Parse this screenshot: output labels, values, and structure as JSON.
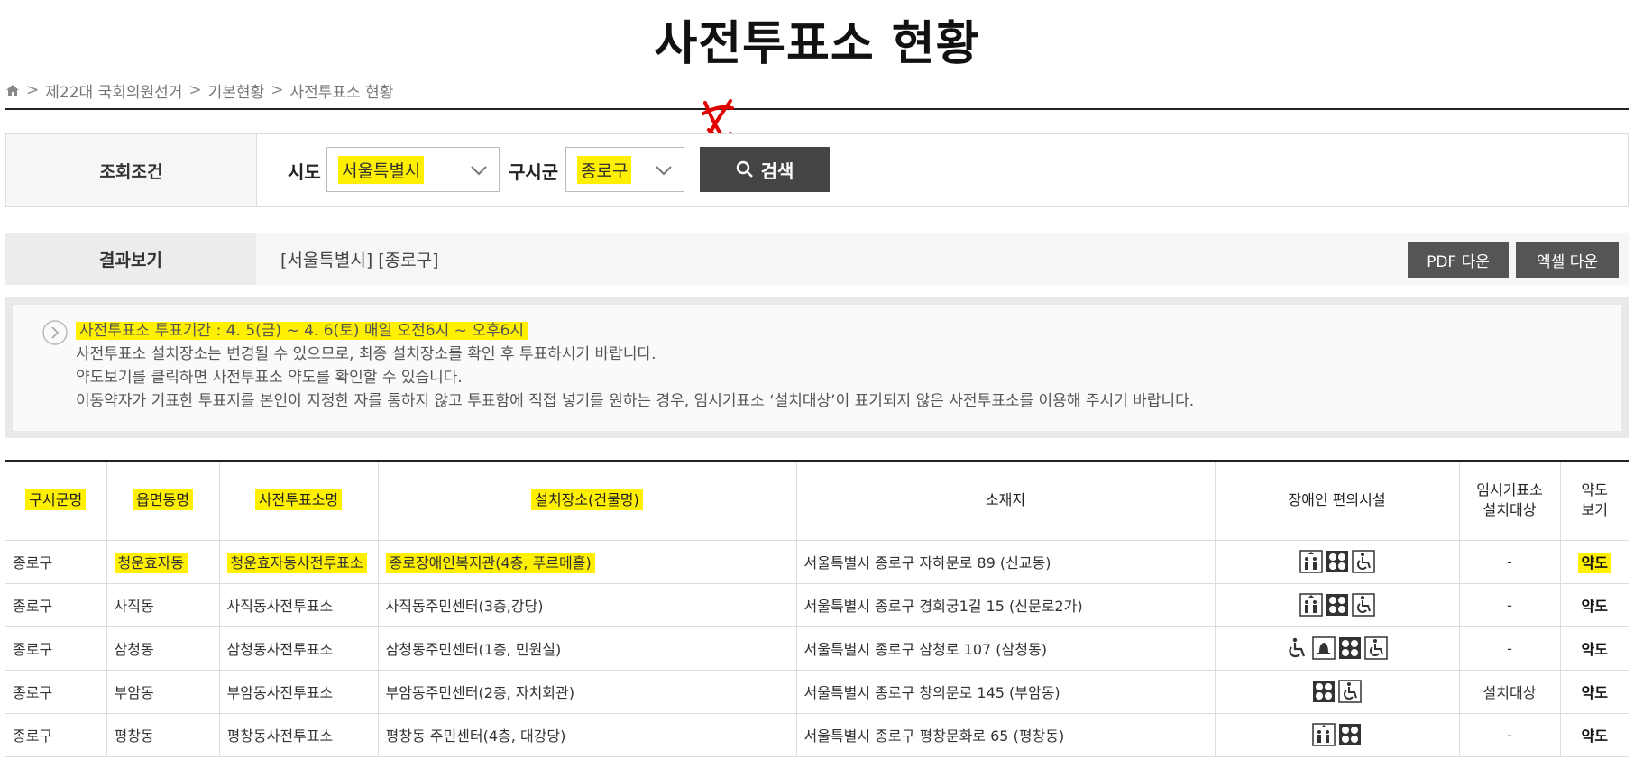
{
  "page_title": "사전투표소 현황",
  "breadcrumb": [
    "제22대 국회의원선거",
    "기본현황",
    "사전투표소 현황"
  ],
  "search": {
    "label": "조회조건",
    "sido_label": "시도",
    "sido_value": "서울특별시",
    "gu_label": "구시군",
    "gu_value": "종로구",
    "button": "검색"
  },
  "result": {
    "label": "결과보기",
    "text": "[서울특별시]  [종로구]",
    "pdf_button": "PDF 다운",
    "excel_button": "엑셀 다운"
  },
  "notice": {
    "line1": "사전투표소 투표기간 : 4. 5(금) ~ 4. 6(토) 매일 오전6시 ~ 오후6시",
    "line2": "사전투표소 설치장소는 변경될 수 있으므로, 최종 설치장소를 확인 후 투표하시기 바랍니다.",
    "line3": "약도보기를 클릭하면 사전투표소 약도를 확인할 수 있습니다.",
    "line4": "이동약자가 기표한 투표지를 본인이 지정한 자를 통하지 않고 투표함에 직접 넣기를 원하는 경우, 임시기표소 ‘설치대상’이 표기되지 않은 사전투표소를 이용해 주시기 바랍니다."
  },
  "table": {
    "headers": {
      "gu": "구시군명",
      "dong": "읍면동명",
      "station": "사전투표소명",
      "place": "설치장소(건물명)",
      "address": "소재지",
      "facility": "장애인 편의시설",
      "temp1": "임시기표소",
      "temp2": "설치대상",
      "map1": "약도",
      "map2": "보기"
    },
    "rows": [
      {
        "gu": "종로구",
        "dong": "청운효자동",
        "station": "청운효자동사전투표소",
        "place": "종로장애인복지관(4층, 푸르메홀)",
        "address": "서울특별시 종로구 자하문로 89 (신교동)",
        "temp": "-",
        "map": "약도"
      },
      {
        "gu": "종로구",
        "dong": "사직동",
        "station": "사직동사전투표소",
        "place": "사직동주민센터(3층,강당)",
        "address": "서울특별시 종로구 경희궁1길 15 (신문로2가)",
        "temp": "-",
        "map": "약도"
      },
      {
        "gu": "종로구",
        "dong": "삼청동",
        "station": "삼청동사전투표소",
        "place": "삼청동주민센터(1층, 민원실)",
        "address": "서울특별시 종로구 삼청로 107 (삼청동)",
        "temp": "-",
        "map": "약도"
      },
      {
        "gu": "종로구",
        "dong": "부암동",
        "station": "부암동사전투표소",
        "place": "부암동주민센터(2층, 자치회관)",
        "address": "서울특별시 종로구 창의문로 145 (부암동)",
        "temp": "설치대상",
        "map": "약도"
      },
      {
        "gu": "종로구",
        "dong": "평창동",
        "station": "평창동사전투표소",
        "place": "평창동 주민센터(4층, 대강당)",
        "address": "서울특별시 종로구 평창문화로 65 (평창동)",
        "temp": "-",
        "map": "약도"
      }
    ]
  },
  "icons": {
    "home": "home-icon",
    "search": "search-icon",
    "chevron": "chevron-down-icon",
    "notice": "chevron-circle-right-icon",
    "facilities": [
      "elevator-icon",
      "braille-block-icon",
      "wheelchair-icon",
      "accessible-entrance-icon",
      "bell-icon"
    ]
  },
  "colors": {
    "highlight": "#ffef00",
    "button_dark": "#444444",
    "annotation_red": "#e00000"
  }
}
